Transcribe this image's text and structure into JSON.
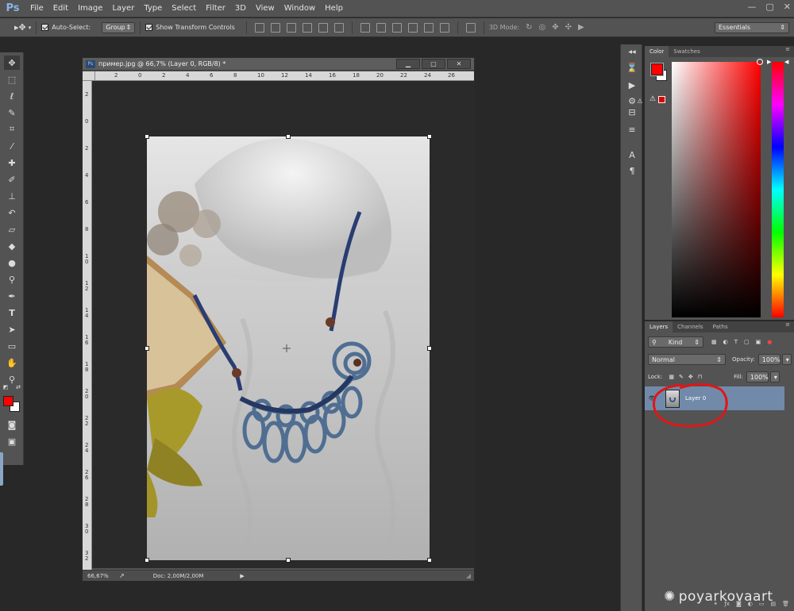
{
  "app": {
    "logo": "Ps"
  },
  "menu": [
    "File",
    "Edit",
    "Image",
    "Layer",
    "Type",
    "Select",
    "Filter",
    "3D",
    "View",
    "Window",
    "Help"
  ],
  "window_controls": [
    "—",
    "▢",
    "✕"
  ],
  "options_bar": {
    "auto_select_label": "Auto-Select:",
    "auto_select_value": "Group",
    "show_transform_label": "Show Transform Controls",
    "mode_label": "3D Mode:",
    "workspace": "Essentials"
  },
  "document": {
    "title": "пример.jpg @ 66,7% (Layer 0, RGB/8) *",
    "zoom": "66,67%",
    "doc_size": "Doc: 2,00M/2,00M",
    "ruler_h": [
      "2",
      "0",
      "2",
      "4",
      "6",
      "8",
      "10",
      "12",
      "14",
      "16",
      "18",
      "20",
      "22",
      "24",
      "26"
    ],
    "ruler_v": [
      "2",
      "0",
      "2",
      "4",
      "6",
      "8",
      "1 0",
      "1 2",
      "1 4",
      "1 6",
      "1 8",
      "2 0",
      "2 2",
      "2 4",
      "2 6",
      "2 8",
      "3 0",
      "3 2"
    ]
  },
  "color_panel": {
    "tabs": [
      "Color",
      "Swatches"
    ],
    "fg_color": "#ff0000",
    "bg_color": "#ffffff",
    "hue_color": "#ff0000"
  },
  "layers_panel": {
    "tabs": [
      "Layers",
      "Channels",
      "Paths"
    ],
    "filter_kind": "Kind",
    "blend_mode": "Normal",
    "opacity_label": "Opacity:",
    "opacity_value": "100%",
    "lock_label": "Lock:",
    "fill_label": "Fill:",
    "fill_value": "100%",
    "layers": [
      {
        "name": "Layer 0"
      }
    ]
  },
  "watermark": "poyarkovaart"
}
